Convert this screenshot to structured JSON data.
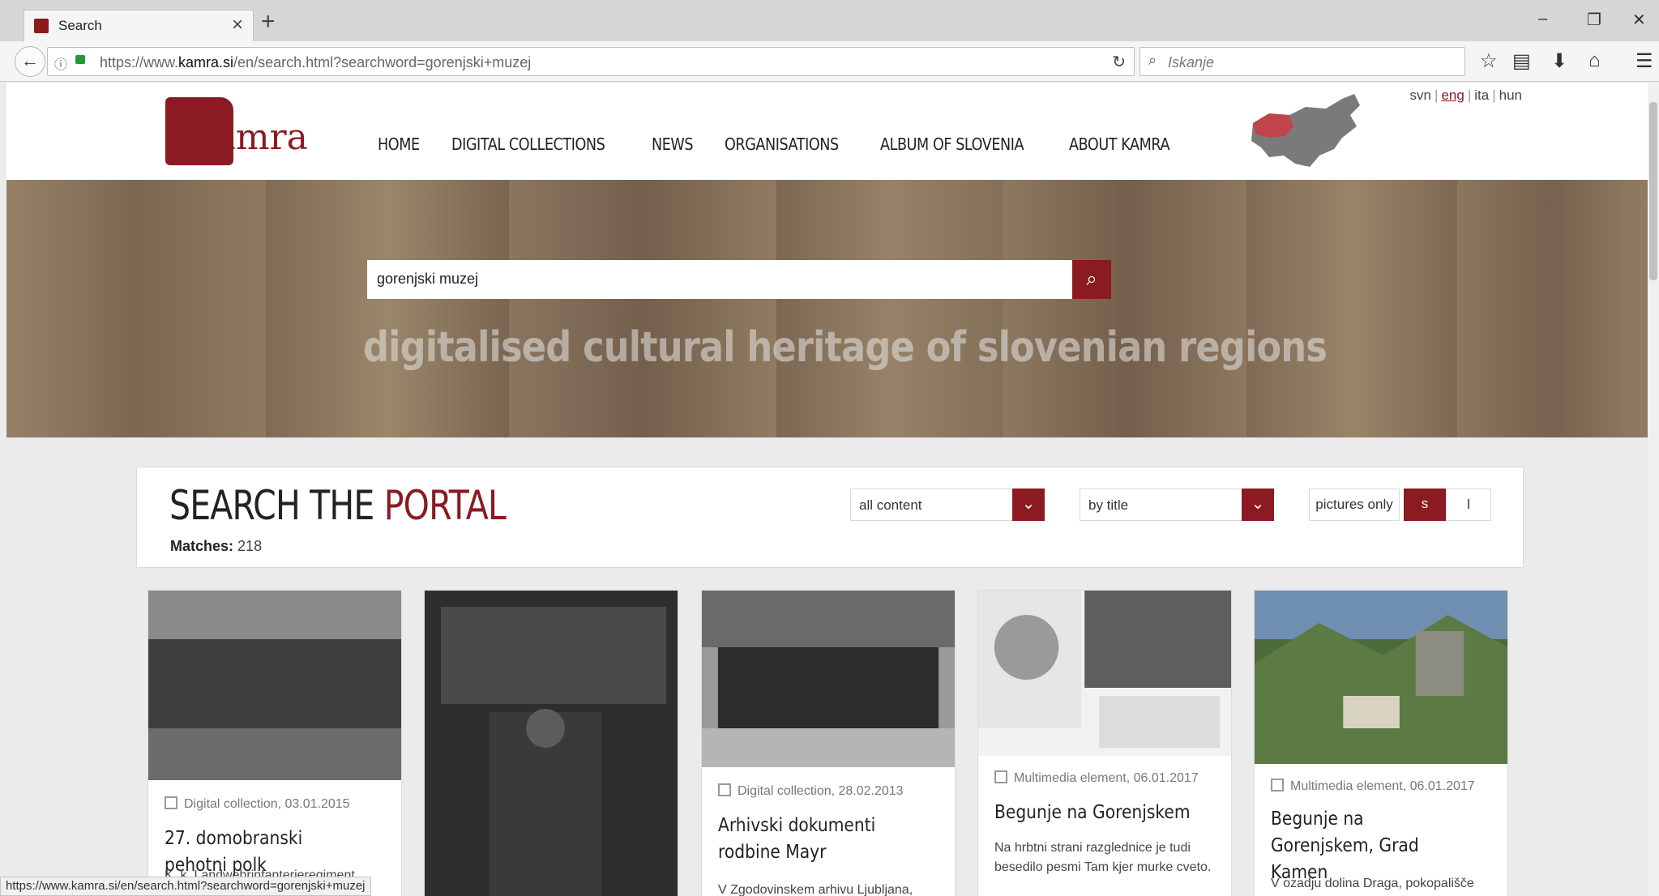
{
  "browser": {
    "tab_title": "Search",
    "url_host_prefix": "https://www.",
    "url_host": "kamra.si",
    "url_path": "/en/search.html?searchword=gorenjski+muzej",
    "search_placeholder": "Iskanje",
    "status_url": "https://www.kamra.si/en/search.html?searchword=gorenjski+muzej"
  },
  "header": {
    "logo_text": "kamra",
    "nav": [
      "HOME",
      "DIGITAL COLLECTIONS",
      "NEWS",
      "ORGANISATIONS",
      "ALBUM OF SLOVENIA",
      "ABOUT KAMRA"
    ],
    "languages": [
      "svn",
      "eng",
      "ita",
      "hun"
    ],
    "active_language": "eng"
  },
  "hero": {
    "search_value": "gorenjski muzej",
    "tagline": "digitalised cultural heritage of slovenian regions"
  },
  "panel": {
    "title_part1": "SEARCH THE ",
    "title_part2": "PORTAL",
    "matches_label": "Matches:",
    "matches_value": "218",
    "filter_content": "all content",
    "filter_sort": "by title",
    "pictures_label": "pictures only",
    "size_s": "s",
    "size_l": "l"
  },
  "cards": [
    {
      "meta": "Digital collection, 03.01.2015",
      "title": "27. domobranski pehotni polk",
      "desc": "K. k. Landwehrinfanterieregiment"
    },
    {
      "meta": "",
      "title": "",
      "desc": ""
    },
    {
      "meta": "Digital collection, 28.02.2013",
      "title": "Arhivski dokumenti rodbine Mayr",
      "desc": "V Zgodovinskem arhivu Ljubljana,"
    },
    {
      "meta": "Multimedia element, 06.01.2017",
      "title": "Begunje na Gorenjskem",
      "desc": "Na hrbtni strani razglednice je tudi besedilo pesmi Tam kjer murke cveto."
    },
    {
      "meta": "Multimedia element, 06.01.2017",
      "title": "Begunje na Gorenjskem, Grad Kamen",
      "desc": "V ozadju dolina Draga, pokopališče"
    }
  ],
  "colors": {
    "brand": "#8b1a22"
  }
}
